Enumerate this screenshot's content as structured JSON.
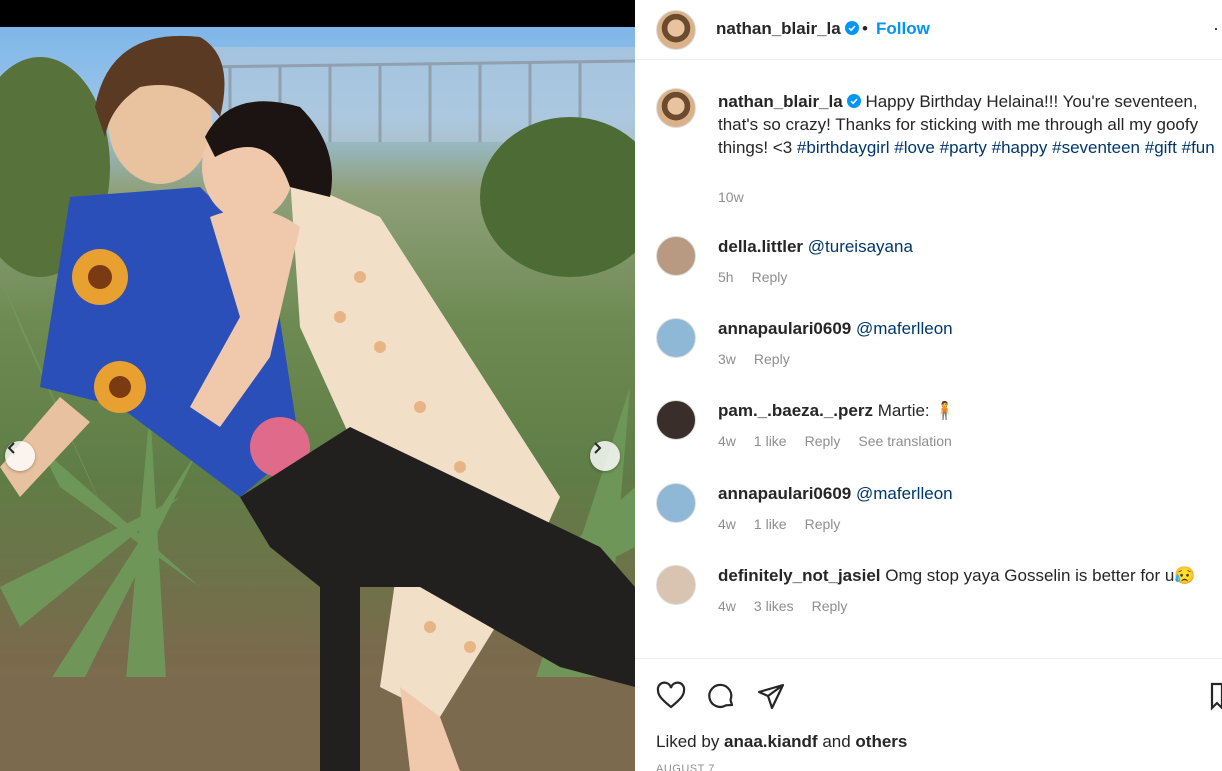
{
  "post": {
    "author": "nathan_blair_la",
    "follow_label": "Follow",
    "separator": "•",
    "more_label": "·",
    "caption": {
      "username": "nathan_blair_la",
      "text": "Happy Birthday Helaina!!! You're seventeen, that's so crazy! Thanks for sticking with me through all my goofy things! <3 ",
      "hashtags": [
        "#birthdaygirl",
        "#love",
        "#party",
        "#happy",
        "#seventeen",
        "#gift",
        "#fun"
      ],
      "time": "10w"
    },
    "photo": {
      "prev_arrow": "‹",
      "next_arrow": "›"
    },
    "comments": [
      {
        "username": "della.littler",
        "text": "@tureisayana",
        "is_mention": true,
        "time": "5h",
        "likes": "",
        "reply": "Reply",
        "translation": "",
        "avatar_color": "#b89a82"
      },
      {
        "username": "annapaulari0609",
        "text": "@maferlleon",
        "is_mention": true,
        "time": "3w",
        "likes": "",
        "reply": "Reply",
        "translation": "",
        "avatar_color": "#8fb8d6"
      },
      {
        "username": "pam._.baeza._.perz",
        "text": "Martie: 🧍",
        "is_mention": false,
        "time": "4w",
        "likes": "1 like",
        "reply": "Reply",
        "translation": "See translation",
        "avatar_color": "#3a2e2a"
      },
      {
        "username": "annapaulari0609",
        "text": "@maferlleon",
        "is_mention": true,
        "time": "4w",
        "likes": "1 like",
        "reply": "Reply",
        "translation": "",
        "avatar_color": "#8fb8d6"
      },
      {
        "username": "definitely_not_jasiel",
        "text": "Omg stop yaya Gosselin is better for u😥",
        "is_mention": false,
        "time": "4w",
        "likes": "3 likes",
        "reply": "Reply",
        "translation": "",
        "avatar_color": "#d8c4b0"
      }
    ],
    "actions": {
      "icons": [
        "heart-icon",
        "comment-icon",
        "share-icon",
        "bookmark-icon"
      ]
    },
    "liked_by": {
      "prefix": "Liked by ",
      "user": "anaa.kiandf",
      "middle": " and ",
      "others": "others"
    },
    "date": "AUGUST 7"
  },
  "colors": {
    "link": "#00376b",
    "follow": "#0095f6",
    "muted": "#8e8e8e",
    "text": "#262626"
  }
}
